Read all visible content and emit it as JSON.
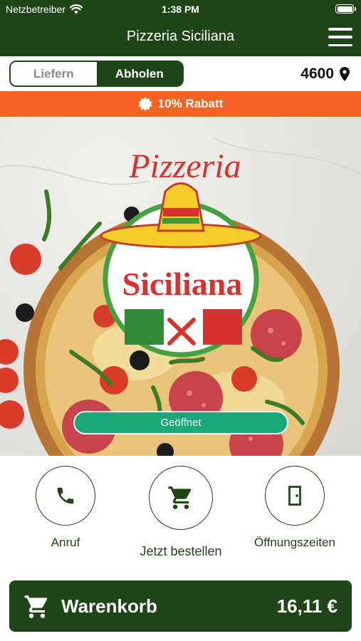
{
  "status_bar": {
    "carrier": "Netzbetreiber",
    "time": "1:38 PM"
  },
  "header": {
    "title": "Pizzeria Siciliana"
  },
  "order_mode": {
    "options": [
      "Liefern",
      "Abholen"
    ],
    "selected": "Abholen",
    "postal_code": "4600"
  },
  "discount": {
    "label": "10% Rabatt"
  },
  "hero": {
    "logo_top": "Pizzeria",
    "logo_name": "Siciliana",
    "status_button": "Geöffnet"
  },
  "actions": [
    {
      "label": "Anruf",
      "icon": "phone-icon"
    },
    {
      "label": "Jetzt bestellen",
      "icon": "cart-icon"
    },
    {
      "label": "Öffnungszeiten",
      "icon": "door-icon"
    }
  ],
  "cart": {
    "label": "Warenkorb",
    "total": "16,11 €"
  },
  "colors": {
    "primary": "#1f4418",
    "accent": "#f46322",
    "open": "#1aa876"
  }
}
